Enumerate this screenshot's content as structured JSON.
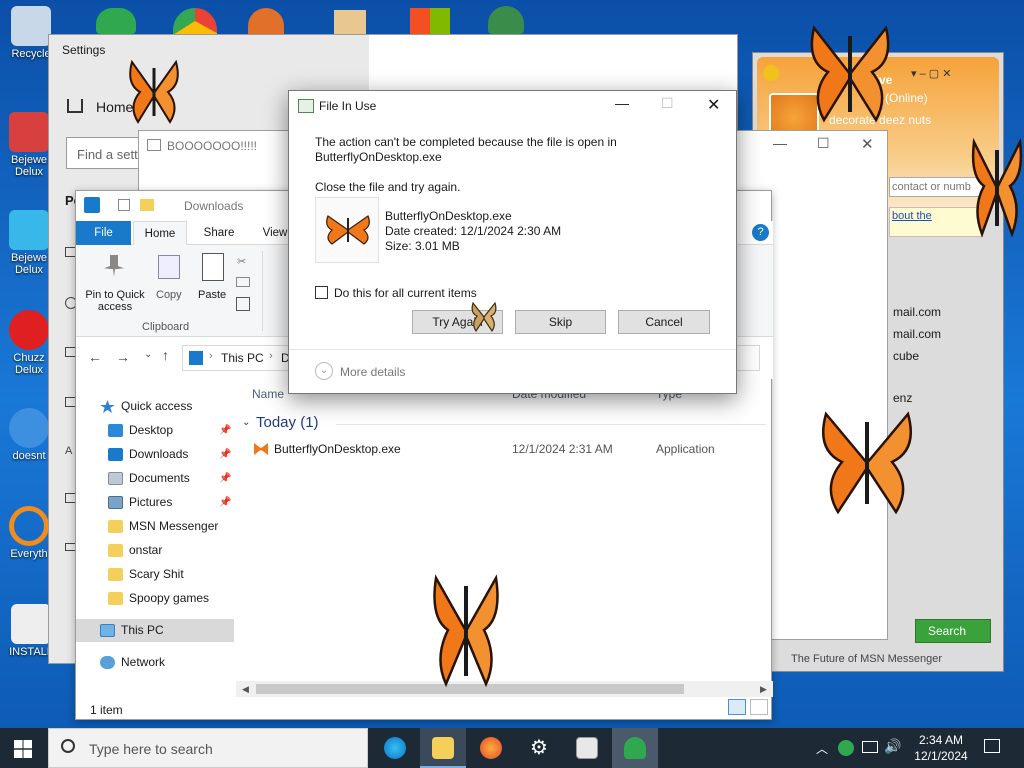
{
  "desktop": {
    "icons": [
      {
        "label": "Recycle"
      },
      {
        "label": "Bejewe Delux"
      },
      {
        "label": "Bejewe Delux"
      },
      {
        "label": "Chuzz Delux"
      },
      {
        "label": "doesnt"
      },
      {
        "label": "Everyth"
      },
      {
        "label": "INSTALL"
      }
    ]
  },
  "settings": {
    "title": "Settings",
    "home": "Home",
    "find_placeholder": "Find a sett"
  },
  "msn": {
    "title": "ws Live",
    "status": "(Online)",
    "personal_message": "decorate deez nuts",
    "search_placeholder": "contact or numb",
    "link": "bout the",
    "contacts": [
      "mail.com",
      "mail.com",
      "cube",
      "enz"
    ],
    "search_button": "Search",
    "footer": "The Future of MSN Messenger"
  },
  "boo": {
    "title": "BOOOOOOO!!!!!"
  },
  "explorer": {
    "title": "Downloads",
    "tabs": [
      "File",
      "Home",
      "Share",
      "View"
    ],
    "ribbon": {
      "pin": "Pin to Quick access",
      "copy": "Copy",
      "paste": "Paste",
      "group": "Clipboard"
    },
    "breadcrumb": [
      "This PC",
      "D"
    ],
    "columns": {
      "name": "Name",
      "date": "Date modified",
      "type": "Type"
    },
    "group_header": "Today (1)",
    "files": [
      {
        "name": "ButterflyOnDesktop.exe",
        "date": "12/1/2024 2:31 AM",
        "type": "Application"
      }
    ],
    "quick_access": "Quick access",
    "nav": [
      {
        "label": "Desktop",
        "pinned": true
      },
      {
        "label": "Downloads",
        "pinned": true
      },
      {
        "label": "Documents",
        "pinned": true
      },
      {
        "label": "Pictures",
        "pinned": true
      },
      {
        "label": "MSN Messenger",
        "pinned": false
      },
      {
        "label": "onstar",
        "pinned": false
      },
      {
        "label": "Scary Shit",
        "pinned": false
      },
      {
        "label": "Spoopy games",
        "pinned": false
      }
    ],
    "this_pc": "This PC",
    "network": "Network",
    "status": "1 item"
  },
  "dialog": {
    "title": "File In Use",
    "message_line1": "The action can't be completed because the file is open in",
    "message_line2": "ButterflyOnDesktop.exe",
    "instruction": "Close the file and try again.",
    "file_name": "ButterflyOnDesktop.exe",
    "date_created": "Date created: 12/1/2024 2:30 AM",
    "size": "Size: 3.01 MB",
    "checkbox_label": "Do this for all current items",
    "buttons": {
      "try_again": "Try Again",
      "skip": "Skip",
      "cancel": "Cancel"
    },
    "more_details": "More details"
  },
  "taskbar": {
    "search_placeholder": "Type here to search",
    "time": "2:34 AM",
    "date": "12/1/2024"
  },
  "colors": {
    "accent": "#0063b1",
    "file_tab": "#1979ca",
    "butterfly": "#f07818",
    "search_green": "#3aa23a"
  }
}
